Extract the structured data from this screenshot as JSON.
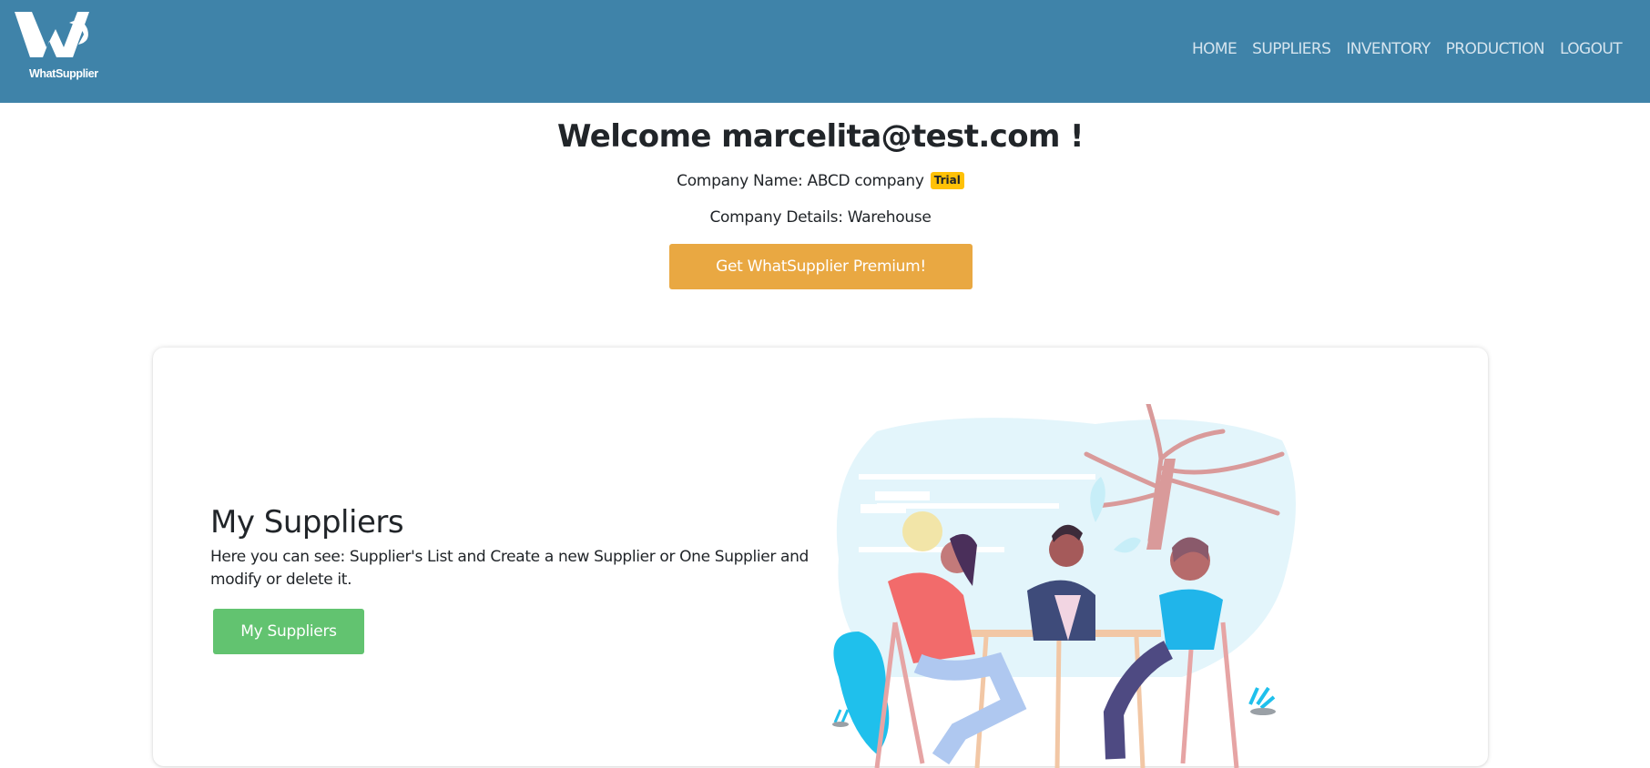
{
  "brand": {
    "name": "WhatSupplier"
  },
  "nav": [
    "HOME",
    "SUPPLIERS",
    "INVENTORY",
    "PRODUCTION",
    "LOGOUT"
  ],
  "welcome": {
    "title": "Welcome marcelita@test.com !",
    "company_label": "Company Name: ABCD company",
    "badge": "Trial",
    "details_label": "Company Details: Warehouse",
    "premium_button": "Get WhatSupplier Premium!"
  },
  "card": {
    "title": "My Suppliers",
    "description": "Here you can see: Supplier's List and Create a new Supplier or One Supplier and modify or delete it.",
    "button": "My Suppliers"
  },
  "colors": {
    "navbar": "#3f83a9",
    "premium": "#e9a842",
    "success": "#62c370",
    "badge": "#ffc107"
  }
}
